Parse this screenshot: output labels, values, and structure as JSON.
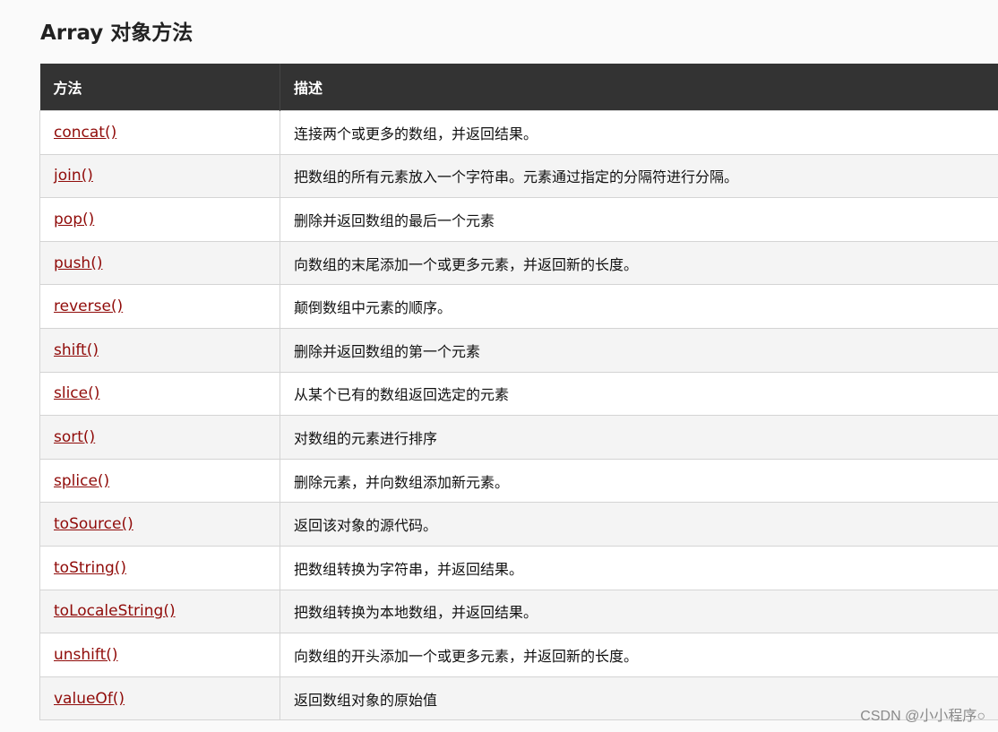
{
  "title": "Array 对象方法",
  "table": {
    "headers": [
      "方法",
      "描述"
    ],
    "rows": [
      {
        "method": "concat()",
        "desc": "连接两个或更多的数组，并返回结果。"
      },
      {
        "method": "join()",
        "desc": "把数组的所有元素放入一个字符串。元素通过指定的分隔符进行分隔。"
      },
      {
        "method": "pop()",
        "desc": "删除并返回数组的最后一个元素"
      },
      {
        "method": "push()",
        "desc": "向数组的末尾添加一个或更多元素，并返回新的长度。"
      },
      {
        "method": "reverse()",
        "desc": "颠倒数组中元素的顺序。"
      },
      {
        "method": "shift()",
        "desc": "删除并返回数组的第一个元素"
      },
      {
        "method": "slice()",
        "desc": "从某个已有的数组返回选定的元素"
      },
      {
        "method": "sort()",
        "desc": "对数组的元素进行排序"
      },
      {
        "method": "splice()",
        "desc": "删除元素，并向数组添加新元素。"
      },
      {
        "method": "toSource()",
        "desc": "返回该对象的源代码。"
      },
      {
        "method": "toString()",
        "desc": "把数组转换为字符串，并返回结果。"
      },
      {
        "method": "toLocaleString()",
        "desc": "把数组转换为本地数组，并返回结果。"
      },
      {
        "method": "unshift()",
        "desc": "向数组的开头添加一个或更多元素，并返回新的长度。"
      },
      {
        "method": "valueOf()",
        "desc": "返回数组对象的原始值"
      }
    ]
  },
  "watermark": "CSDN @小小程序○",
  "colors": {
    "header_bg": "#333333",
    "link": "#900b09",
    "row_alt": "#f4f4f4"
  }
}
